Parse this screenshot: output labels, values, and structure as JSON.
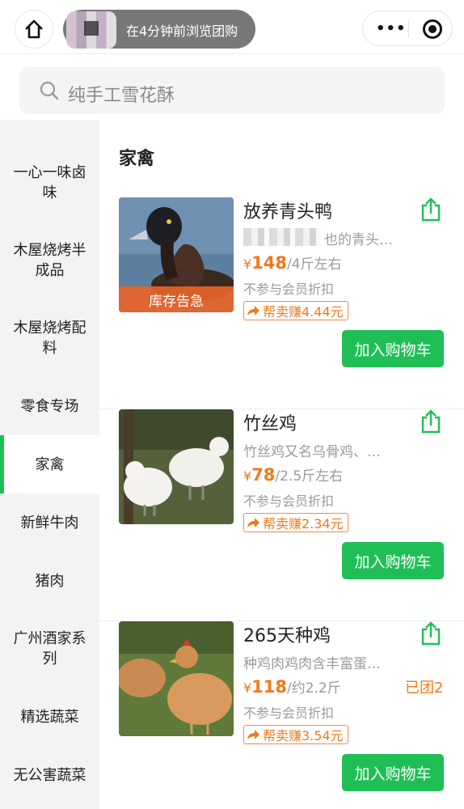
{
  "header": {
    "notice_text": "在4分钟前浏览团购",
    "icons": [
      "home-icon",
      "more-dots-icon",
      "target-icon"
    ]
  },
  "search": {
    "placeholder": "纯手工雪花酥"
  },
  "sidebar": {
    "items": [
      {
        "label": "一心一味卤味"
      },
      {
        "label": "木屋烧烤半成品"
      },
      {
        "label": "木屋烧烤配料"
      },
      {
        "label": "零食专场"
      },
      {
        "label": "家禽",
        "active": true
      },
      {
        "label": "新鲜牛肉"
      },
      {
        "label": "猪肉"
      },
      {
        "label": "广州酒家系列"
      },
      {
        "label": "精选蔬菜"
      },
      {
        "label": "无公害蔬菜"
      }
    ]
  },
  "main": {
    "category_title": "家禽",
    "products": [
      {
        "name": "放养青头鸭",
        "description": "也的青头…",
        "price_symbol": "¥",
        "price": "148",
        "unit": "/4斤左右",
        "member_note": "不参与会员折扣",
        "earn_label": "帮卖赚4.44元",
        "stock_tag": "库存告急",
        "cart_label": "加入购物车"
      },
      {
        "name": "竹丝鸡",
        "description": "竹丝鸡又名乌骨鸡、…",
        "price_symbol": "¥",
        "price": "78",
        "unit": "/2.5斤左右",
        "member_note": "不参与会员折扣",
        "earn_label": "帮卖赚2.34元",
        "cart_label": "加入购物车"
      },
      {
        "name": "265天种鸡",
        "description": "种鸡肉鸡肉含丰富蛋…",
        "price_symbol": "¥",
        "price": "118",
        "unit": "/约2.2斤",
        "member_note": "不参与会员折扣",
        "earn_label": "帮卖赚3.54元",
        "group_count": "已团2",
        "cart_label": "加入购物车"
      }
    ]
  },
  "colors": {
    "accent_green": "#1fbf56",
    "price_orange": "#f07a1a",
    "sidebar_bg": "#f3f3f3"
  }
}
